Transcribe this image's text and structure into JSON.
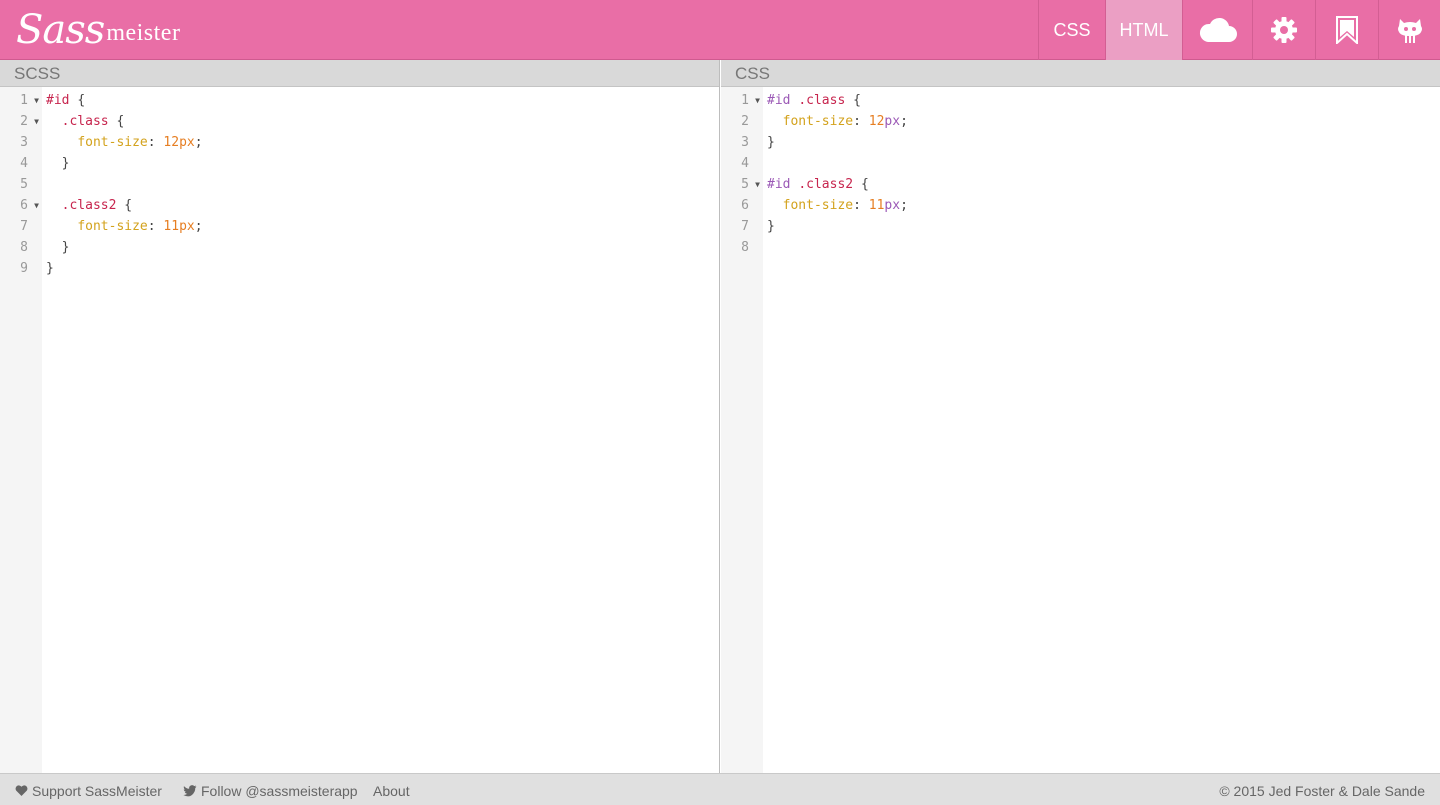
{
  "app": {
    "logo_sass": "Sass",
    "logo_meister": "meister"
  },
  "nav": {
    "css_label": "CSS",
    "html_label": "HTML",
    "icons": [
      "cloud-icon",
      "gear-icon",
      "bookmark-icon",
      "github-icon"
    ]
  },
  "left_panel": {
    "title": "SCSS",
    "line_numbers": [
      "1",
      "2",
      "3",
      "4",
      "5",
      "6",
      "7",
      "8",
      "9"
    ],
    "lines": [
      "#id {",
      "  .class {",
      "    font-size: 12px;",
      "  }",
      "",
      "  .class2 {",
      "    font-size: 11px;",
      "  }",
      "}"
    ]
  },
  "right_panel": {
    "title": "CSS",
    "line_numbers": [
      "1",
      "2",
      "3",
      "4",
      "5",
      "6",
      "7",
      "8"
    ],
    "lines": [
      "#id .class {",
      "  font-size: 12px;",
      "}",
      "",
      "#id .class2 {",
      "  font-size: 11px;",
      "}",
      ""
    ]
  },
  "footer": {
    "support": "Support SassMeister",
    "follow": "Follow @sassmeisterapp",
    "about": "About",
    "copyright": "© 2015 Jed Foster & Dale Sande"
  },
  "colors": {
    "brand": "#e96ea6",
    "active_nav": "#eb9fc4"
  }
}
